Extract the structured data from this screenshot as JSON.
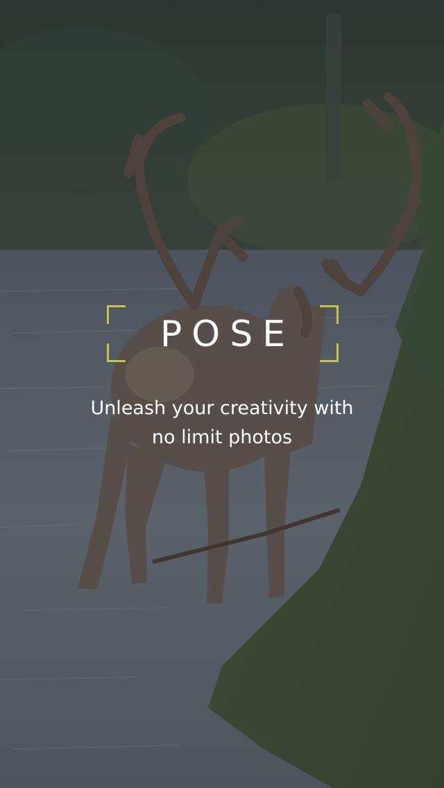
{
  "splash": {
    "brand": "POSE",
    "tagline_line1": "Unleash your creativity with",
    "tagline_line2": "no limit photos"
  },
  "colors": {
    "accent": "#c9c24a",
    "text": "#ffffff",
    "overlay": "#282c32"
  },
  "icons": {
    "logo_frame": "corner-bracket-frame"
  },
  "background_image": "caribou-in-river"
}
